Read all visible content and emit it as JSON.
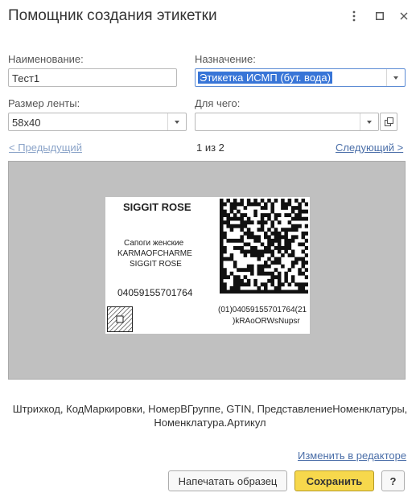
{
  "window": {
    "title": "Помощник создания этикетки"
  },
  "form": {
    "name_label": "Наименование:",
    "name_value": "Тест1",
    "purpose_label": "Назначение:",
    "purpose_value": "Этикетка ИСМП (бут. вода)",
    "tape_size_label": "Размер ленты:",
    "tape_size_value": "58x40",
    "for_what_label": "Для чего:",
    "for_what_value": ""
  },
  "pager": {
    "prev_label": "< Предыдущий",
    "position": "1 из 2",
    "next_label": "Следующий >"
  },
  "preview_label": {
    "brand": "SIGGIT ROSE",
    "desc_line1": "Сапоги женские",
    "desc_line2": "KARMAOFCHARME",
    "desc_line3": "SIGGIT ROSE",
    "gtin": "04059155701764",
    "code_line1": "(01)04059155701764(21",
    "code_line2": ")kRAoORWsNupsr"
  },
  "fields_list": {
    "line1": "Штрихкод, КодМаркировки, НомерВГруппе, GTIN, ПредставлениеНоменклатуры,",
    "line2": "Номенклатура.Артикул"
  },
  "actions": {
    "edit_in_editor": "Изменить в редакторе",
    "print_sample": "Напечатать образец",
    "save": "Сохранить",
    "help": "?"
  },
  "colors": {
    "link": "#4a6ea8",
    "accent": "#f7d84c",
    "selection": "#3875d7"
  }
}
